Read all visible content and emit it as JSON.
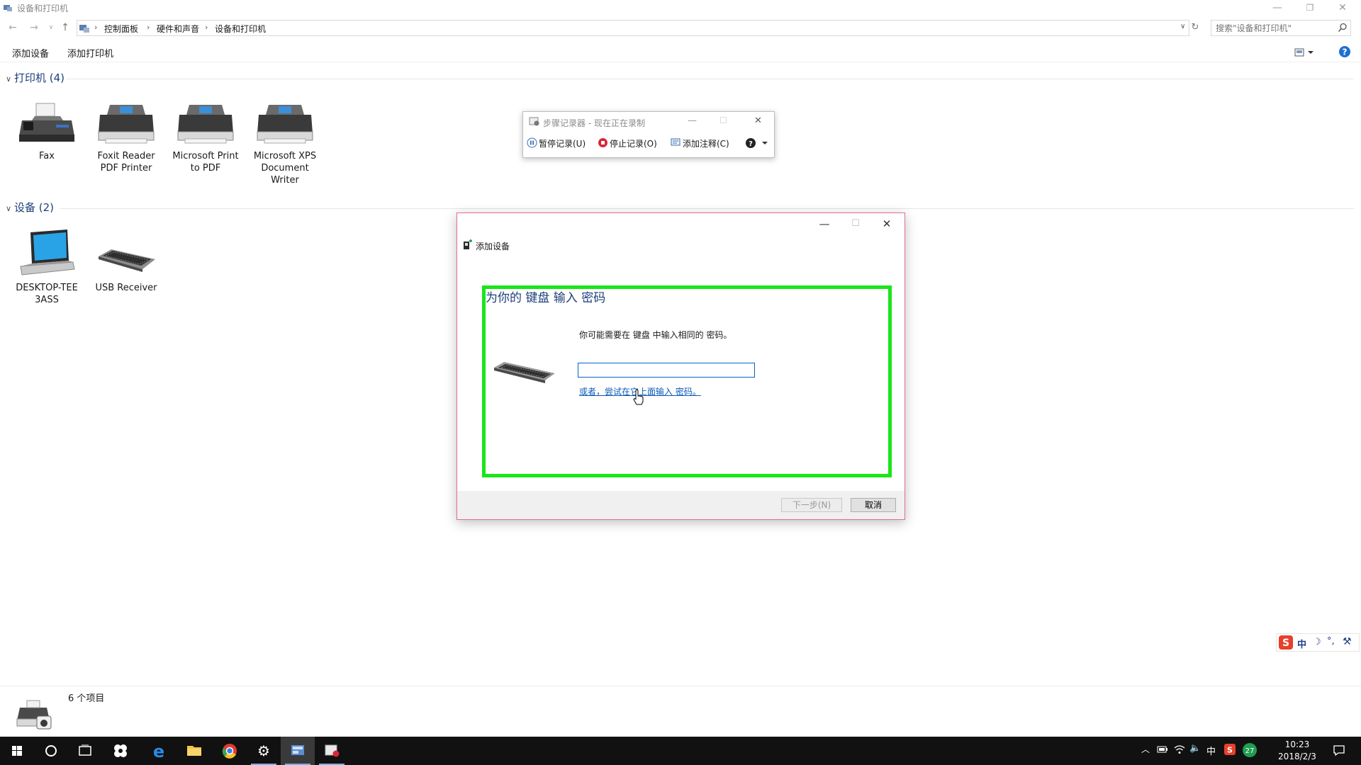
{
  "window": {
    "title": "设备和打印机"
  },
  "address": {
    "crumbs": [
      "控制面板",
      "硬件和声音",
      "设备和打印机"
    ],
    "search_placeholder": "搜索\"设备和打印机\""
  },
  "commands": {
    "add_device": "添加设备",
    "add_printer": "添加打印机"
  },
  "groups": {
    "printers": {
      "header": "打印机 (4)",
      "items": [
        {
          "label": "Fax"
        },
        {
          "label": "Foxit Reader PDF Printer"
        },
        {
          "label": "Microsoft Print to PDF"
        },
        {
          "label": "Microsoft XPS Document Writer"
        }
      ]
    },
    "devices": {
      "header": "设备 (2)",
      "items": [
        {
          "label": "DESKTOP-TEE3ASS"
        },
        {
          "label": "USB Receiver"
        }
      ]
    }
  },
  "psr": {
    "title": "步骤记录器 - 现在正在录制",
    "pause": "暂停记录(U)",
    "stop": "停止记录(O)",
    "comment": "添加注释(C)"
  },
  "dialog": {
    "title": "添加设备",
    "heading": "为你的 键盘 输入 密码",
    "description": "你可能需要在 键盘 中输入相同的 密码。",
    "pin_value": "",
    "alt_link": "或者，尝试在它上面输入 密码。",
    "next": "下一步(N)",
    "cancel": "取消"
  },
  "status": {
    "count": "6 个项目"
  },
  "taskbar": {
    "time": "10:23",
    "date": "2018/2/3",
    "ime": "中",
    "badge": "27"
  },
  "ime_bar": {
    "lang": "中"
  },
  "colors": {
    "accent": "#1e3f7a",
    "highlight": "#19e619",
    "link": "#0b5ab8"
  }
}
